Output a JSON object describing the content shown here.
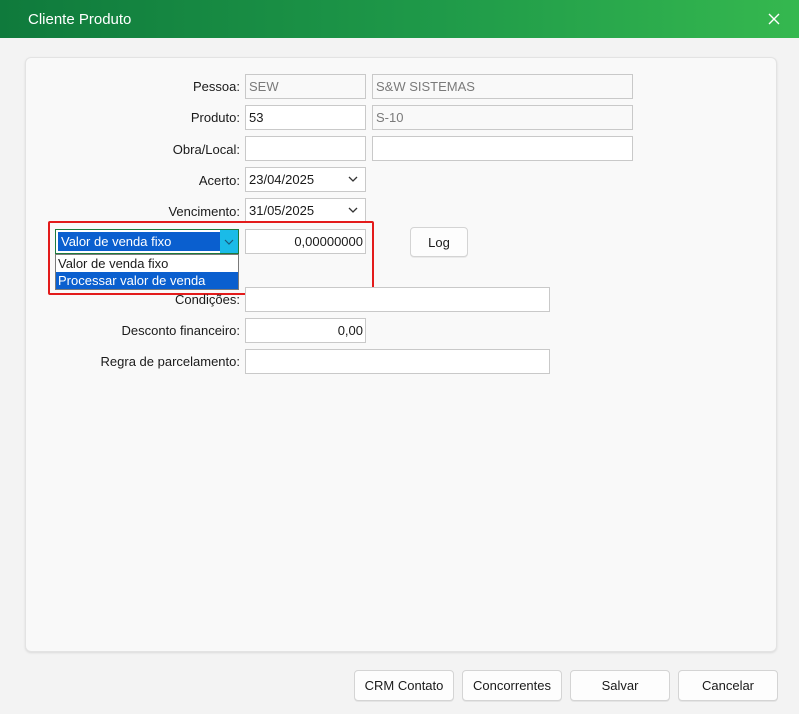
{
  "window": {
    "title": "Cliente Produto"
  },
  "form": {
    "pessoa": {
      "label": "Pessoa:",
      "code": "SEW",
      "name": "S&W SISTEMAS"
    },
    "produto": {
      "label": "Produto:",
      "code": "53",
      "name": "S-10"
    },
    "obra_local": {
      "label": "Obra/Local:",
      "code": "",
      "name": ""
    },
    "acerto": {
      "label": "Acerto:",
      "value": "23/04/2025"
    },
    "vencimento": {
      "label": "Vencimento:",
      "value": "31/05/2025"
    },
    "valor_tipo": {
      "selected": "Valor de venda fixo",
      "options": [
        "Valor de venda fixo",
        "Processar valor de venda"
      ],
      "highlighted_index": 1
    },
    "valor": {
      "value": "0,00000000"
    },
    "log_button": "Log",
    "condicoes": {
      "label": "Condições:",
      "value": ""
    },
    "desconto_financeiro": {
      "label": "Desconto financeiro:",
      "value": "0,00"
    },
    "regra_parcelamento": {
      "label": "Regra de parcelamento:",
      "value": ""
    }
  },
  "footer": {
    "crm_contato": "CRM Contato",
    "concorrentes": "Concorrentes",
    "salvar": "Salvar",
    "cancelar": "Cancelar"
  },
  "colors": {
    "title_gradient_start": "#0f7a3c",
    "title_gradient_end": "#35b84f",
    "selection": "#0a5fcf",
    "highlight_border": "#e31b1b"
  }
}
